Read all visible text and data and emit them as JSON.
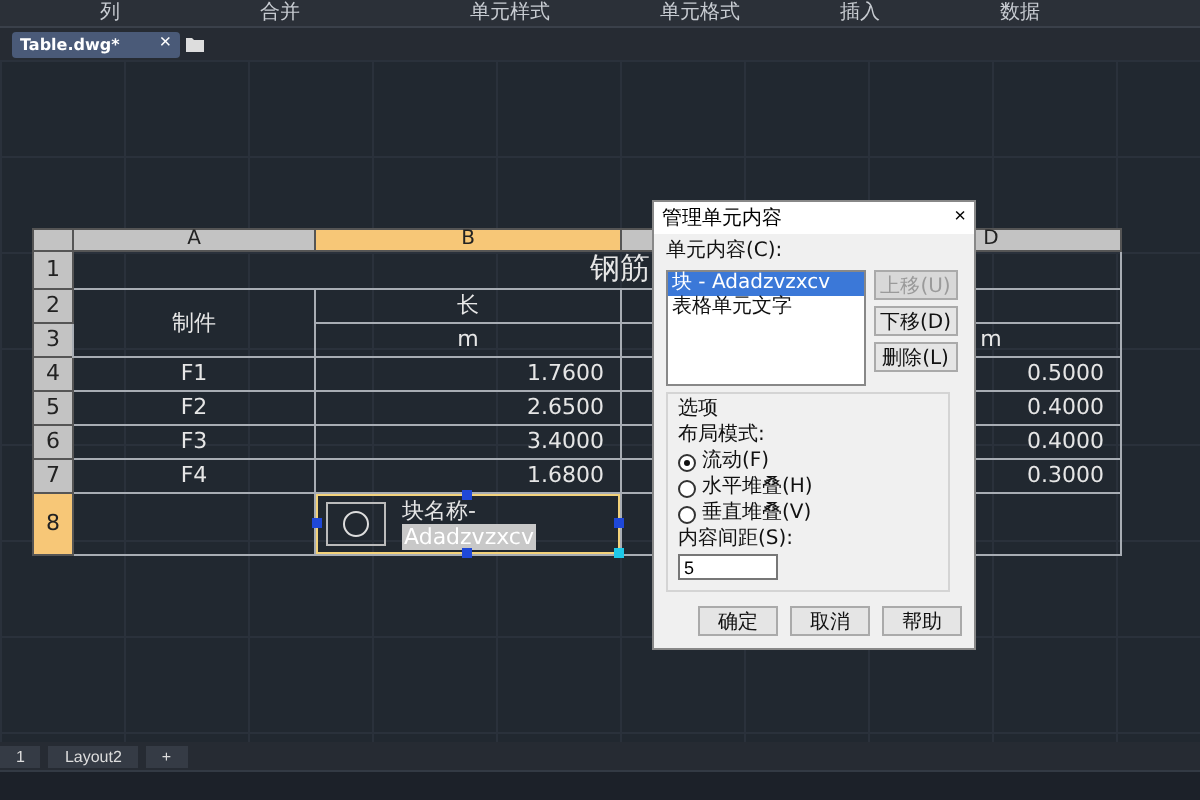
{
  "ribbon_labels": [
    "列",
    "合并",
    "单元样式",
    "单元格式",
    "插入",
    "数据"
  ],
  "file_tab": {
    "title": "Table.dwg*",
    "close": "×"
  },
  "table": {
    "columns": [
      {
        "label": "A",
        "selected": false
      },
      {
        "label": "B",
        "selected": true
      },
      {
        "selected": false
      },
      {
        "label": "D",
        "selected": false
      }
    ],
    "row_labels": [
      {
        "label": "1",
        "selected": false
      },
      {
        "label": "2",
        "selected": false
      },
      {
        "label": "3",
        "selected": false
      },
      {
        "label": "4",
        "selected": false
      },
      {
        "label": "5",
        "selected": false
      },
      {
        "label": "6",
        "selected": false
      },
      {
        "label": "7",
        "selected": false
      },
      {
        "label": "8",
        "selected": true
      }
    ],
    "title": "钢筋",
    "header": {
      "part": "制件",
      "length": "长",
      "length_unit": "m",
      "d_unit": "m"
    },
    "rows": [
      {
        "part": "F1",
        "length": "1.7600",
        "d": "0.5000"
      },
      {
        "part": "F2",
        "length": "2.6500",
        "d": "0.4000"
      },
      {
        "part": "F3",
        "length": "3.4000",
        "d": "0.4000"
      },
      {
        "part": "F4",
        "length": "1.6800",
        "d": "0.3000"
      }
    ],
    "block_cell": {
      "name_label": "块名称-",
      "name_value": "Adadzvzxcv"
    }
  },
  "dialog": {
    "title": "管理单元内容",
    "close": "×",
    "content_label": "单元内容(C):",
    "content_items": [
      {
        "label": "块 - Adadzvzxcv",
        "selected": true
      },
      {
        "label": "表格单元文字",
        "selected": false
      }
    ],
    "side_buttons": [
      {
        "label": "上移(U)",
        "disabled": true
      },
      {
        "label": "下移(D)",
        "disabled": false
      },
      {
        "label": "删除(L)",
        "disabled": false
      }
    ],
    "options_title": "选项",
    "layout_label": "布局模式:",
    "layout_modes": [
      {
        "label": "流动(F)",
        "selected": true
      },
      {
        "label": "水平堆叠(H)",
        "selected": false
      },
      {
        "label": "垂直堆叠(V)",
        "selected": false
      }
    ],
    "spacing_label": "内容间距(S):",
    "spacing_value": "5",
    "buttons": [
      "确定",
      "取消",
      "帮助"
    ]
  },
  "layout_tabs": [
    "1",
    "Layout2",
    "+"
  ]
}
